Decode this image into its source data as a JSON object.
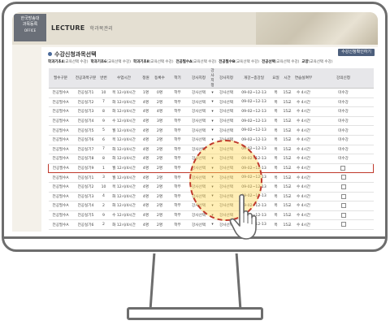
{
  "header": {
    "logo_lines": [
      "한국방송대",
      "과목등록",
      "OFFICE"
    ],
    "section": "LECTURE",
    "section_sub": "학과목관리"
  },
  "page": {
    "title": "수강신청과목선택",
    "apply_button": "수강신청확인하기"
  },
  "filters": [
    {
      "bold": "학과기초4",
      "rest": "(교육선택 수강)"
    },
    {
      "bold": "학과기초6",
      "rest": "(교육선택 수강)"
    },
    {
      "bold": "학과기초8",
      "rest": "(교육선택 수강)"
    },
    {
      "bold": "전공필수A",
      "rest": "(교육선택 수강)"
    },
    {
      "bold": "전공필수B",
      "rest": "(교육선택 수강)"
    },
    {
      "bold": "전공선택",
      "rest": "(교육선택 수강)"
    },
    {
      "bold": "교양",
      "rest": "(교육선택 수강)"
    }
  ],
  "table": {
    "columns": [
      "필수구분",
      "전공과목구분",
      "반번",
      "수업시간",
      "정원",
      "등록수",
      "학기",
      "강사지정",
      "강사지정",
      "강사지정",
      "개강~종강일",
      "요일",
      "시간",
      "연습실여부",
      "강의신청"
    ],
    "rows": [
      [
        "전공필수A",
        "전공실기1",
        "10",
        "목 12시/4시간",
        "1명",
        "0명",
        "학부",
        "강사선택",
        "▾",
        "강사선택",
        "09-02~12-13",
        "목",
        "15교",
        "수 4시간",
        ""
      ],
      [
        "전공필수A",
        "전공실기2",
        "7",
        "화 12시/4시간",
        "4명",
        "2명",
        "학부",
        "강사선택",
        "▾",
        "강사선택",
        "09-02~12-13",
        "목",
        "15교",
        "수 4시간",
        ""
      ],
      [
        "전공필수A",
        "전공실기3",
        "8",
        "화 12시/4시간",
        "4명",
        "4명",
        "학부",
        "강사선택",
        "▾",
        "강사선택",
        "09-02~12-13",
        "목",
        "15교",
        "수 4시간",
        ""
      ],
      [
        "전공필수A",
        "전공실기4",
        "9",
        "수 12시/4시간",
        "4명",
        "3명",
        "학부",
        "강사선택",
        "▾",
        "강사선택",
        "09-02~12-13",
        "목",
        "15교",
        "수 4시간",
        ""
      ],
      [
        "전공필수A",
        "전공실기5",
        "5",
        "월 12시/4시간",
        "4명",
        "2명",
        "학부",
        "강사선택",
        "▾",
        "강사선택",
        "09-02~12-13",
        "목",
        "15교",
        "수 4시간",
        ""
      ],
      [
        "전공필수A",
        "전공실기6",
        "6",
        "목 12시/4시간",
        "4명",
        "2명",
        "학부",
        "강사선택",
        "▾",
        "강사선택",
        "09-02~12-13",
        "목",
        "15교",
        "수 4시간",
        ""
      ],
      [
        "전공필수A",
        "전공실기7",
        "7",
        "화 12시/4시간",
        "4명",
        "2명",
        "학부",
        "강사선택",
        "▾",
        "강사선택",
        "09-02~12-13",
        "목",
        "15교",
        "수 4시간",
        ""
      ],
      [
        "전공필수A",
        "전공실기8",
        "8",
        "화 12시/4시간",
        "4명",
        "2명",
        "학부",
        "강사선택",
        "▾",
        "강사선택",
        "09-02~12-13",
        "목",
        "15교",
        "수 4시간",
        ""
      ],
      [
        "전공필수A",
        "전공실기9",
        "1",
        "월 12시/4시간",
        "4명",
        "2명",
        "학부",
        "강사선택",
        "▾",
        "강사선택",
        "09-02~12-13",
        "목",
        "15교",
        "수 4시간",
        ""
      ],
      [
        "전공필수A",
        "전공실기1",
        "3",
        "월 12시/4시간",
        "4명",
        "2명",
        "학부",
        "강사선택",
        "▾",
        "강사선택",
        "09-02~12-13",
        "목",
        "15교",
        "수 4시간",
        ""
      ],
      [
        "전공필수A",
        "전공실기2",
        "10",
        "목 12시/4시간",
        "4명",
        "2명",
        "학부",
        "강사선택",
        "▾",
        "강사선택",
        "09-02~12-13",
        "목",
        "15교",
        "수 4시간",
        ""
      ],
      [
        "전공필수A",
        "전공실기3",
        "4",
        "화 12시/4시간",
        "4명",
        "2명",
        "학부",
        "강사선택",
        "▾",
        "강사선택",
        "09-02~12-13",
        "목",
        "15교",
        "수 4시간",
        ""
      ],
      [
        "전공필수A",
        "전공실기4",
        "2",
        "화 12시/4시간",
        "4명",
        "2명",
        "학부",
        "강사선택",
        "▾",
        "강사선택",
        "09-02~12-13",
        "목",
        "15교",
        "수 4시간",
        ""
      ],
      [
        "전공필수A",
        "전공실기5",
        "9",
        "수 12시/4시간",
        "4명",
        "2명",
        "학부",
        "강사선택",
        "▾",
        "강사선택",
        "09-02~12-13",
        "목",
        "15교",
        "수 4시간",
        ""
      ],
      [
        "전공필수A",
        "전공실기6",
        "2",
        "화 12시/4시간",
        "4명",
        "2명",
        "학부",
        "강사선택",
        "▾",
        "강사선택",
        "09-02~12-13",
        "목",
        "15교",
        "수 4시간",
        ""
      ]
    ],
    "highlighted_row": 8,
    "checkbox_rows": [
      8,
      9,
      10,
      11,
      12,
      13,
      14
    ],
    "status_text": "미수강"
  },
  "colors": {
    "highlight_border": "#c0392b",
    "focus_circle": "#ffd650",
    "monitor_frame": "#6d6d6d"
  }
}
